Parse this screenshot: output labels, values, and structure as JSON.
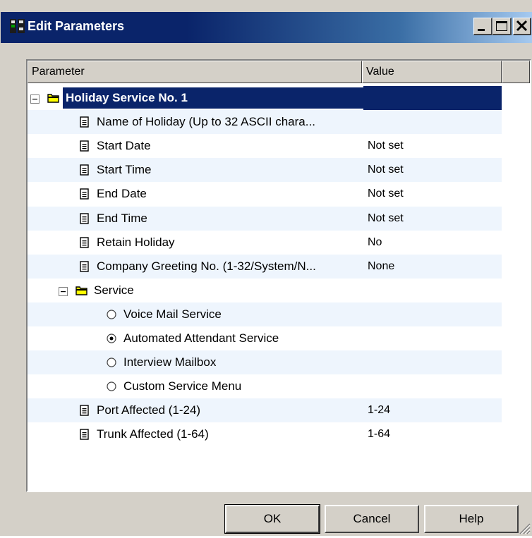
{
  "window": {
    "title": "Edit Parameters"
  },
  "columns": {
    "parameter": "Parameter",
    "value": "Value"
  },
  "rows": [
    {
      "label": "Holiday Service No. 1",
      "value": "",
      "kind": "folder"
    },
    {
      "label": "Name of Holiday (Up to 32 ASCII chara...",
      "value": "",
      "kind": "item"
    },
    {
      "label": "Start Date",
      "value": "Not set",
      "kind": "item"
    },
    {
      "label": "Start Time",
      "value": "Not set",
      "kind": "item"
    },
    {
      "label": "End Date",
      "value": "Not set",
      "kind": "item"
    },
    {
      "label": "End Time",
      "value": "Not set",
      "kind": "item"
    },
    {
      "label": "Retain Holiday",
      "value": "No",
      "kind": "item"
    },
    {
      "label": "Company Greeting No. (1-32/System/N...",
      "value": "None",
      "kind": "item"
    },
    {
      "label": "Service",
      "value": "",
      "kind": "folder"
    },
    {
      "label": "Voice Mail Service",
      "value": "",
      "kind": "radio",
      "checked": false
    },
    {
      "label": "Automated Attendant Service",
      "value": "",
      "kind": "radio",
      "checked": true
    },
    {
      "label": "Interview Mailbox",
      "value": "",
      "kind": "radio",
      "checked": false
    },
    {
      "label": "Custom Service Menu",
      "value": "",
      "kind": "radio",
      "checked": false
    },
    {
      "label": "Port Affected (1-24)",
      "value": "1-24",
      "kind": "item"
    },
    {
      "label": "Trunk Affected (1-64)",
      "value": "1-64",
      "kind": "item"
    }
  ],
  "buttons": {
    "ok": "OK",
    "cancel": "Cancel",
    "help": "Help"
  },
  "colors": {
    "titlebar": "#0a246a",
    "selection": "#0a246a",
    "face": "#d4d0c8",
    "folder": "#ffff00",
    "alt_row": "#eef5fd"
  }
}
